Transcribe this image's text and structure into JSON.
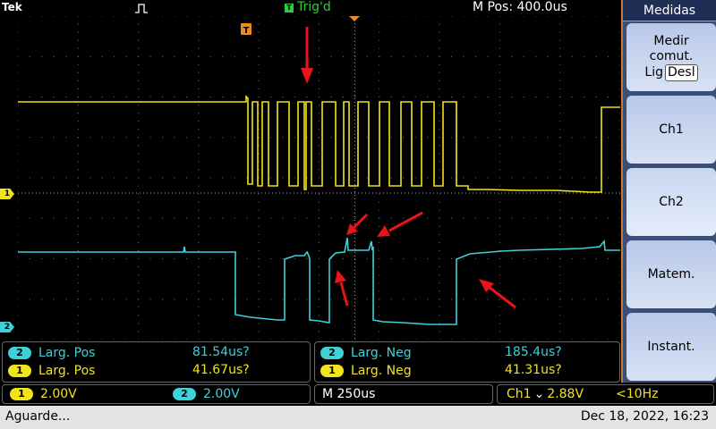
{
  "topbar": {
    "brand": "Tek",
    "trigger_status": "Trig'd",
    "trigger_badge": "T",
    "horizontal_position": "M Pos: 400.0us"
  },
  "menu": {
    "title": "Medidas",
    "buttons": [
      {
        "label_line1": "Medir",
        "label_line2": "comut.",
        "toggle_on": "Lig",
        "toggle_off": "Desl"
      },
      {
        "label": "Ch1"
      },
      {
        "label": "Ch2"
      },
      {
        "label": "Matem."
      },
      {
        "label": "Instant."
      }
    ]
  },
  "measurements": {
    "left": [
      {
        "channel": "2",
        "name": "Larg. Pos",
        "value": "81.54us?"
      },
      {
        "channel": "1",
        "name": "Larg. Pos",
        "value": "41.67us?"
      }
    ],
    "right": [
      {
        "channel": "2",
        "name": "Larg. Neg",
        "value": "185.4us?"
      },
      {
        "channel": "1",
        "name": "Larg. Neg",
        "value": "41.31us?"
      }
    ]
  },
  "settings": {
    "ch1_badge": "1",
    "ch1_scale": "2.00V",
    "ch2_badge": "2",
    "ch2_scale": "2.00V",
    "timebase": "M 250us",
    "trigger_source": "Ch1",
    "trigger_slope": "⌄",
    "trigger_level": "2.88V",
    "trigger_freq": "<10Hz"
  },
  "status": {
    "message": "Aguarde...",
    "datetime": "Dec 18, 2022, 16:23"
  },
  "markers": {
    "ch1": "1",
    "ch2": "2",
    "trigger_pos": "T"
  },
  "colors": {
    "ch1": "#f2e31a",
    "ch2": "#3fd0d8",
    "arrow": "#e8141a",
    "trig_green": "#2ecc40",
    "trigger_orange": "#f08c1e"
  }
}
